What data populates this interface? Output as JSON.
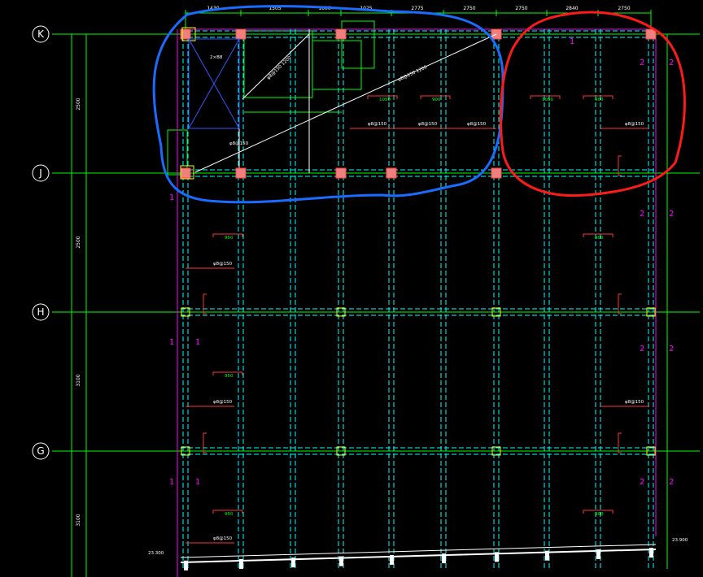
{
  "axes": {
    "rows": [
      "K",
      "J",
      "H",
      "G"
    ]
  },
  "top_dims": [
    "1430",
    "1505",
    "1600",
    "1025",
    "2775",
    "2750",
    "2750",
    "2840",
    "2750"
  ],
  "left_dims": [
    "2500",
    "2500",
    "3100",
    "3100"
  ],
  "beam_notes": {
    "note_a": "φ8@150",
    "note_b": "φ8@150",
    "note_c": "φ8@150",
    "note_d": "φ8@150",
    "note_e": "φ8@150",
    "note_f": "φ8@150",
    "note_g": "φ8@150",
    "note_h": "φ8@150"
  },
  "diagonal_labels": {
    "diag1": "φ8@150 1200",
    "diag2": "φ8@150 1200",
    "diag3": "φ8@150"
  },
  "red_values": {
    "r1": "1050",
    "r2": "1050",
    "r3": "900",
    "r4": "950",
    "r5": "950",
    "r6": "950",
    "r7": "900",
    "r8": "900",
    "r9": "900"
  },
  "section_marks": {
    "one": "1",
    "two": "2"
  },
  "elevations": {
    "left": "23.300",
    "right": "23.900"
  },
  "opening_label": "2×B8",
  "colors": {
    "grid": "#00ff00",
    "beam": "#00ffff",
    "column": "#ff6666",
    "blue_outline": "#1a6cff",
    "red_outline": "#ff1a1a",
    "section": "#ff00ff"
  }
}
